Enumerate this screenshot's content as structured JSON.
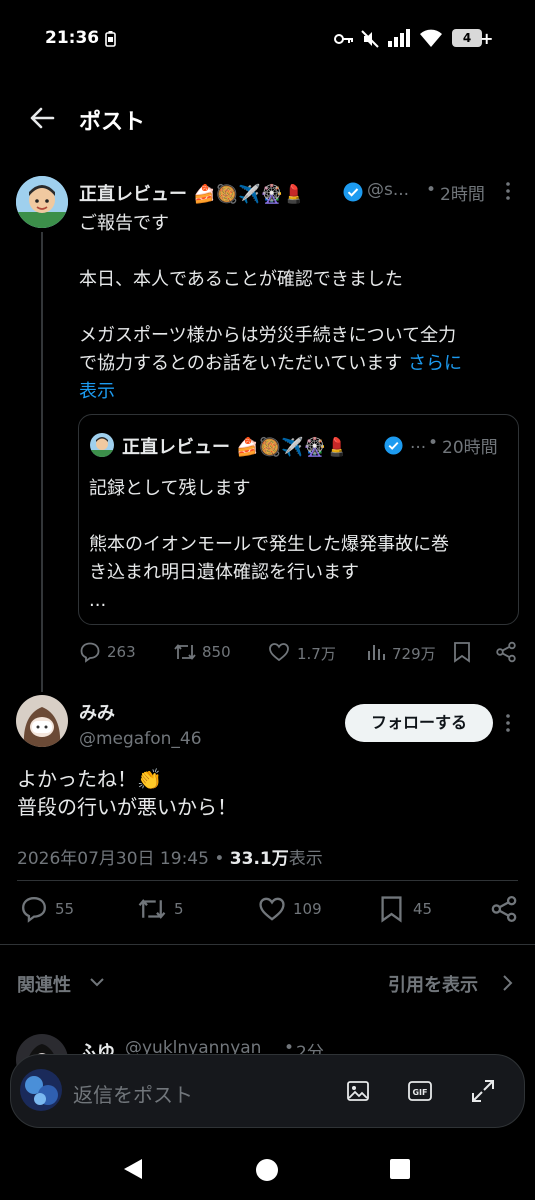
{
  "status_bar": {
    "time": "21:36",
    "battery": "4"
  },
  "header": {
    "title": "ポスト"
  },
  "quoted_post": {
    "author_name": "正直レビュー 🍰🥘✈️🎡💄",
    "handle": "@s...",
    "time": "2時間",
    "text_lines": [
      "ご報告です",
      "",
      "本日、本人であることが確認できました",
      "",
      "メガスポーツ様からは労災手続きについて全力",
      "で協力するとのお話をいただいています"
    ],
    "more_label_1": "さらに",
    "more_label_2": "表示",
    "embedded": {
      "author_name": "正直レビュー 🍰🥘✈️🎡💄",
      "handle": "...",
      "time": "20時間",
      "line1": "記録として残します",
      "line2": "熊本のイオンモールで発生した爆発事故に巻",
      "line3": "き込まれ明日遺体確認を行います",
      "line4": "..."
    },
    "stats": {
      "replies": "263",
      "reposts": "850",
      "likes": "1.7万",
      "views": "729万"
    }
  },
  "main_post": {
    "author_name": "みみ",
    "handle": "@megafon_46",
    "follow_label": "フォローする",
    "line1": "よかったね！👏",
    "line2": "普段の行いが悪いから！",
    "timestamp": "2026年07月30日 19:45",
    "view_count": "33.1万",
    "view_label": "表示",
    "stats": {
      "replies": "55",
      "reposts": "5",
      "likes": "109",
      "bookmarks": "45"
    }
  },
  "sort_bar": {
    "relevance": "関連性",
    "show_quotes": "引用を表示"
  },
  "next_reply": {
    "author_name": "ふゆ",
    "handle": "@yuklnyannyan",
    "time": "2分"
  },
  "reply_bar": {
    "placeholder": "返信をポスト"
  },
  "colors": {
    "background": "#000000",
    "accent": "#1d9bf0",
    "muted": "#71767b",
    "verified": "#1d9bf0"
  }
}
